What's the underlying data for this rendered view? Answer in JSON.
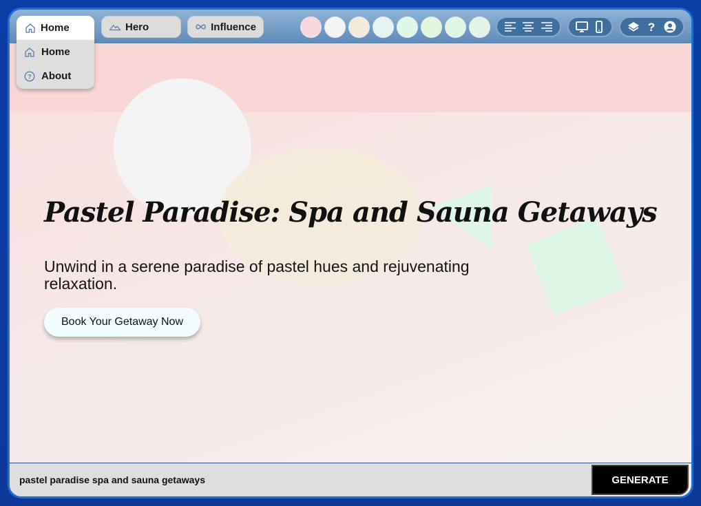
{
  "nav": {
    "tabs": [
      {
        "label": "Home",
        "icon": "home-icon"
      },
      {
        "label": "Hero",
        "icon": "mountain-icon"
      },
      {
        "label": "Influence",
        "icon": "infinity-icon"
      }
    ],
    "dropdown": [
      {
        "label": "Home",
        "icon": "home-icon"
      },
      {
        "label": "About",
        "icon": "help-circle-icon"
      }
    ]
  },
  "palette": [
    "#f9d7de",
    "#f2f4f5",
    "#f2ebdc",
    "#e4f4f3",
    "#dff7ea",
    "#e2f6df",
    "#def6e2",
    "#e2f4ea"
  ],
  "tools": {
    "align": [
      "align-left-icon",
      "align-center-icon",
      "align-right-icon"
    ],
    "device": [
      "desktop-icon",
      "mobile-icon"
    ],
    "misc": [
      "layers-icon",
      "help-icon",
      "user-icon"
    ]
  },
  "hero": {
    "title": "Pastel Paradise: Spa and Sauna Getaways",
    "subtitle": "Unwind in a serene paradise of pastel hues and rejuvenating relaxation.",
    "cta": "Book Your Getaway Now"
  },
  "footer": {
    "prompt_value": "pastel paradise spa and sauna getaways",
    "generate_label": "GENERATE"
  },
  "colors": {
    "frame": "#0b3a9a",
    "topbar": "#6f97c2",
    "band": "#f9d7d7",
    "circle_white": "#f4f4f4",
    "circle_cream": "#f3ebdc",
    "triangle_mint": "#def6ea",
    "square_mint": "#d9f6e4",
    "generate_bg": "#000000"
  }
}
